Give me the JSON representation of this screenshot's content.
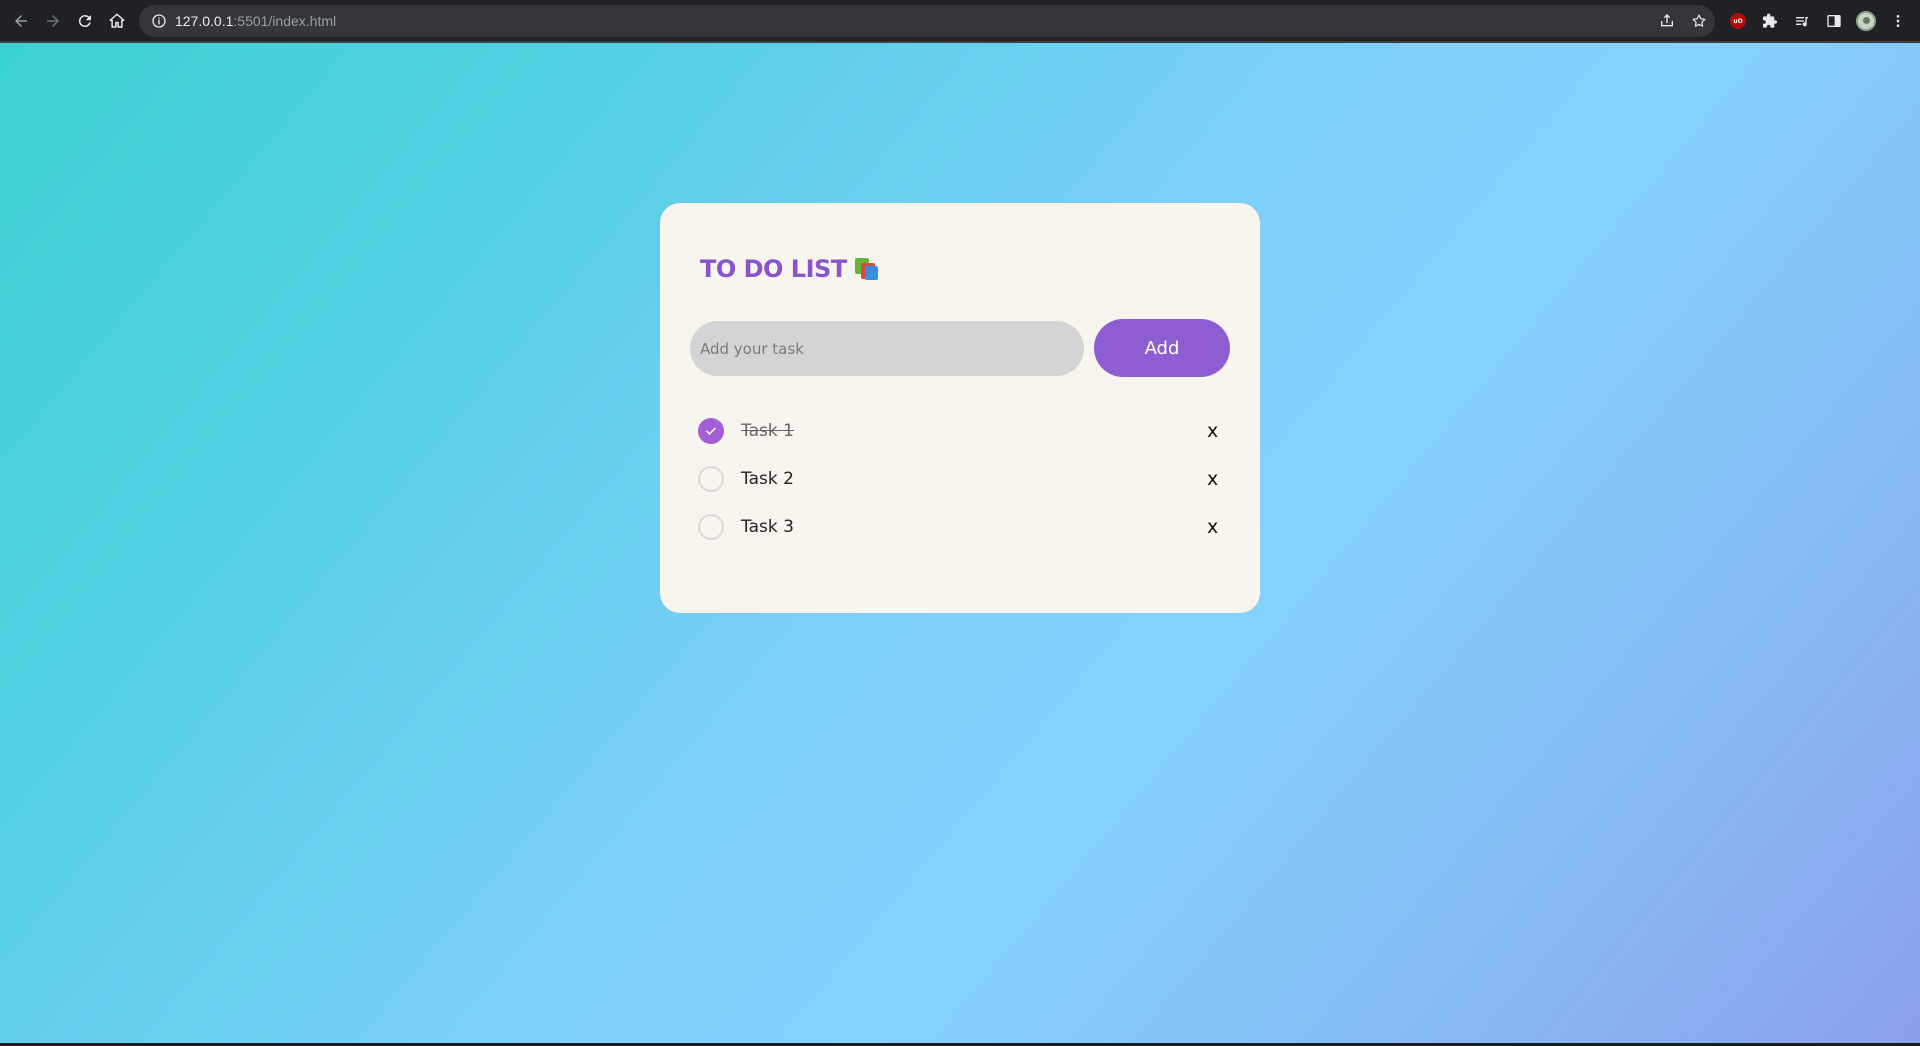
{
  "browser": {
    "url_host": "127.0.0.1",
    "url_rest": ":5501/index.html",
    "extension_badge": "uO"
  },
  "app": {
    "title": "TO DO LIST",
    "title_icon": "stacked-books-icon",
    "input_placeholder": "Add your task",
    "input_value": "",
    "add_label": "Add",
    "accent_color": "#8e5dd2",
    "tasks": [
      {
        "label": "Task 1",
        "done": true,
        "delete_label": "x"
      },
      {
        "label": "Task 2",
        "done": false,
        "delete_label": "x"
      },
      {
        "label": "Task 3",
        "done": false,
        "delete_label": "x"
      }
    ]
  }
}
